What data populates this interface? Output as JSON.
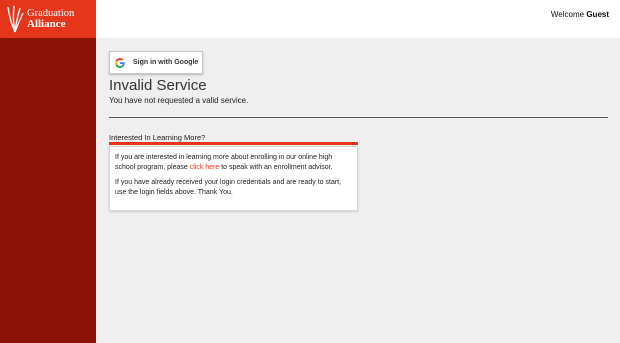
{
  "brand": {
    "line1": "Graduation",
    "line2": "Alliance",
    "logo_icon": "graduation-alliance-logo",
    "sidebar_color": "#8a1207",
    "accent_color": "#e5361c"
  },
  "header": {
    "welcome_label": "Welcome",
    "user_name": "Guest"
  },
  "auth": {
    "google_button_label": "Sign in with Google",
    "google_icon": "google-g-icon"
  },
  "page": {
    "title": "Invalid Service",
    "message": "You have not requested a valid service."
  },
  "info_panel": {
    "heading": "Interested In Learning More?",
    "para1_before": "If you are interested in learning more about enrolling in our online high school program, please ",
    "para1_link": "click here",
    "para1_after": " to speak with an enrollment advisor.",
    "para2": "If you have already received your login credentials and are ready to start, use the login fields above. Thank You."
  }
}
